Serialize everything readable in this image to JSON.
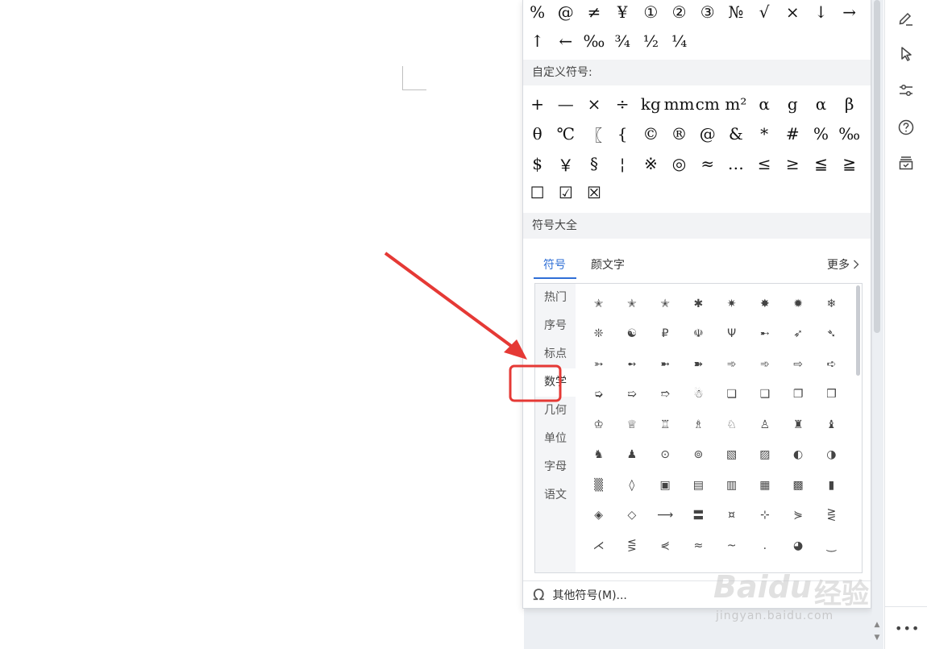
{
  "recent_symbols": [
    [
      "%",
      "@",
      "≠",
      "¥",
      "①",
      "②",
      "③",
      "№",
      "√",
      "×",
      "↓",
      "→"
    ],
    [
      "↑",
      "←",
      "‰",
      "¾",
      "½",
      "¼"
    ]
  ],
  "custom_section": {
    "title": "自定义符号:",
    "rows": [
      [
        "+",
        "—",
        "×",
        "÷",
        "kg",
        "mm",
        "cm",
        "m²",
        "α",
        "g",
        "α",
        "β"
      ],
      [
        "θ",
        "℃",
        "〖",
        "{",
        "©",
        "®",
        "@",
        "&",
        "*",
        "#",
        "%",
        "‰"
      ],
      [
        "$",
        "￥",
        "§",
        "¦",
        "※",
        "◎",
        "≈",
        "…",
        "≤",
        "≥",
        "≦",
        "≧"
      ],
      [
        "☐",
        "☑",
        "☒"
      ]
    ]
  },
  "library": {
    "title": "符号大全",
    "tabs": [
      "符号",
      "颜文字"
    ],
    "more_label": "更多",
    "categories": [
      "热门",
      "序号",
      "标点",
      "数学",
      "几何",
      "单位",
      "字母",
      "语文"
    ],
    "grid": [
      [
        "✭",
        "✭",
        "✭",
        "✱",
        "✷",
        "✸",
        "✹",
        "❄"
      ],
      [
        "❊",
        "☯",
        "₽",
        "☫",
        "Ψ",
        "➸",
        "➶",
        "➴"
      ],
      [
        "➳",
        "➻",
        "➼",
        "➽",
        "➾",
        "➾",
        "⇨",
        "➪"
      ],
      [
        "➭",
        "➯",
        "➱",
        "☃",
        "❏",
        "❑",
        "❐",
        "❒"
      ],
      [
        "♔",
        "♕",
        "♖",
        "♗",
        "♘",
        "♙",
        "♜",
        "♝"
      ],
      [
        "♞",
        "♟",
        "⊙",
        "⊚",
        "▧",
        "▨",
        "◐",
        "◑"
      ],
      [
        "▒",
        "◊",
        "▣",
        "▤",
        "▥",
        "▦",
        "▩",
        "▮"
      ],
      [
        "◈",
        "◇",
        "⟶",
        "〓",
        "¤",
        "⊹",
        "⋟",
        "⋛"
      ],
      [
        "⋌",
        "⋚",
        "⋞",
        "≈",
        "~",
        ".",
        "◕",
        "‿"
      ]
    ]
  },
  "footer_label": "其他符号(M)...",
  "watermark": {
    "brand": "Baidu",
    "cn": "经验",
    "url": "jingyan.baidu.com"
  },
  "colors": {
    "accent": "#2f6fd6",
    "highlight": "#e53935"
  }
}
